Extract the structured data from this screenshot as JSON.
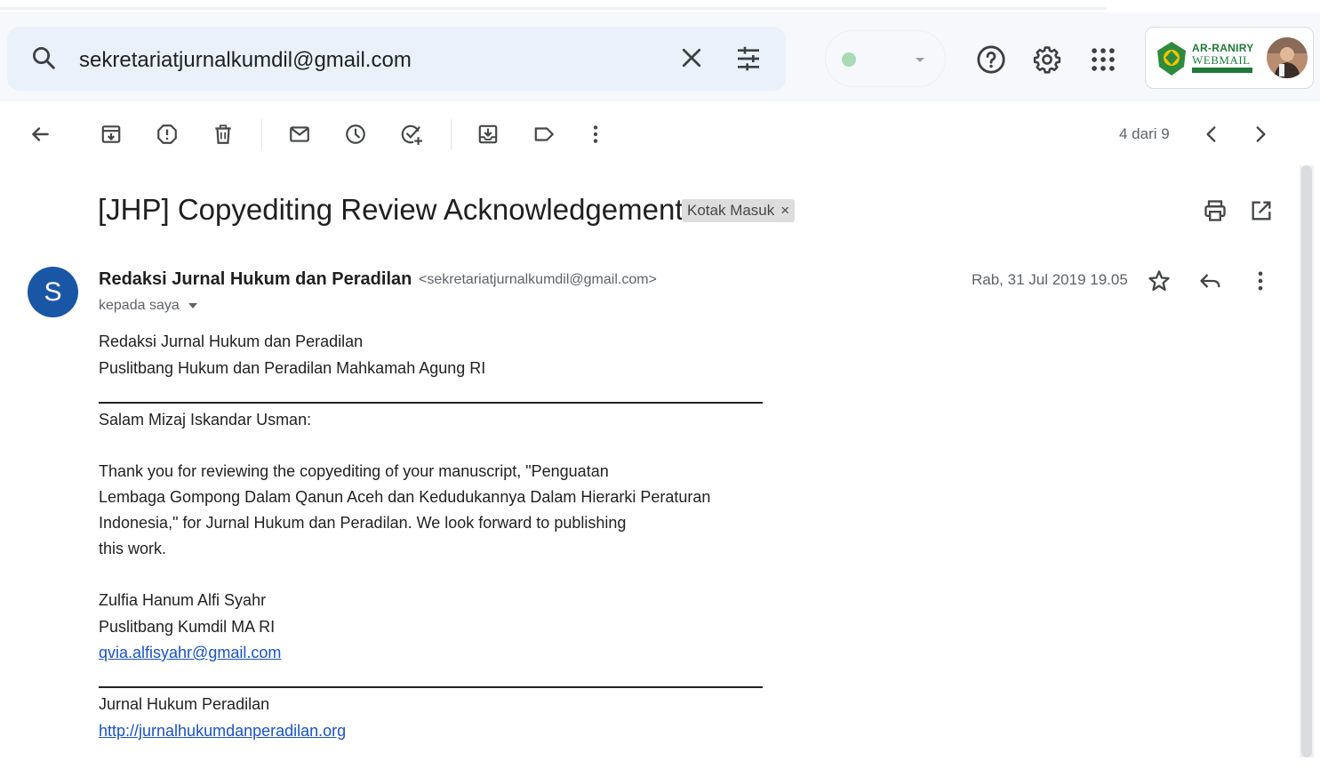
{
  "search": {
    "query": "sekretariatjurnalkumdil@gmail.com",
    "icon": "search-icon",
    "clear_icon": "close-icon",
    "filter_icon": "tune-icon"
  },
  "status": {
    "color": "#a8dab5"
  },
  "brand": {
    "line1": "AR-RANIRY",
    "line2": "WEBMAIL"
  },
  "toolbar": {
    "pager_text": "4 dari 9",
    "icons": [
      "arrow-back-icon",
      "archive-icon",
      "report-spam-icon",
      "delete-icon",
      "mark-unread-icon",
      "snooze-icon",
      "add-task-icon",
      "move-to-icon",
      "label-icon",
      "more-vert-icon"
    ]
  },
  "email": {
    "subject": "[JHP] Copyediting Review Acknowledgement",
    "label": "Kotak Masuk",
    "label_remove": "×",
    "avatar_letter": "S",
    "sender_name": "Redaksi Jurnal Hukum dan Peradilan",
    "sender_email": "<sekretariatjurnalkumdil@gmail.com>",
    "recipient": "kepada saya",
    "date": "Rab, 31 Jul 2019 19.05",
    "body": {
      "header_line1": "Redaksi Jurnal Hukum dan Peradilan",
      "header_line2": "Puslitbang Hukum dan Peradilan Mahkamah Agung RI",
      "greeting": "Salam Mizaj Iskandar Usman:",
      "para_line1": "Thank you for reviewing the copyediting of your manuscript, \"Penguatan",
      "para_line2": "Lembaga Gompong Dalam Qanun Aceh dan Kedudukannya Dalam Hierarki Peraturan",
      "para_line3": "Indonesia,\" for Jurnal Hukum dan Peradilan. We look forward to publishing",
      "para_line4": "this work.",
      "sig_name": "Zulfia Hanum Alfi Syahr",
      "sig_org": "Puslitbang Kumdil MA RI",
      "sig_email": "qvia.alfisyahr@gmail.com",
      "footer_name": "Jurnal Hukum Peradilan",
      "footer_url": "http://jurnalhukumdanperadilan.org"
    }
  }
}
